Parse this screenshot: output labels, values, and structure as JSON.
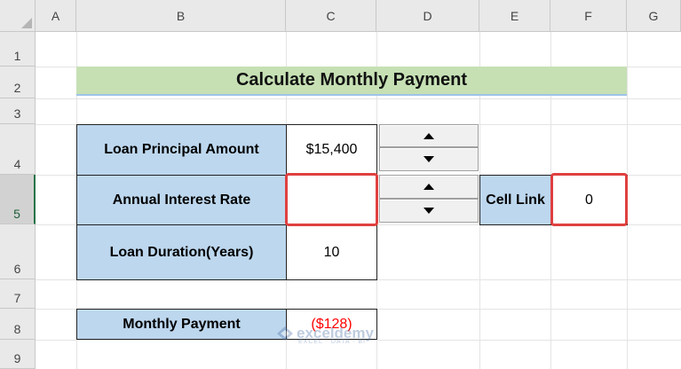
{
  "columns": [
    "A",
    "B",
    "C",
    "D",
    "E",
    "F",
    "G"
  ],
  "rows": [
    "1",
    "2",
    "3",
    "4",
    "5",
    "6",
    "7",
    "8",
    "9"
  ],
  "sheet": {
    "title": "Calculate Monthly Payment",
    "principal_label": "Loan Principal Amount",
    "principal_value": "$15,400",
    "rate_label": "Annual Interest Rate",
    "rate_value": "",
    "duration_label": "Loan Duration(Years)",
    "duration_value": "10",
    "payment_label": "Monthly Payment",
    "payment_value": "($128)",
    "cell_link_label": "Cell Link",
    "cell_link_value": "0"
  },
  "watermark": {
    "name": "exceldemy",
    "tagline": "EXCEL · DATA · BI"
  },
  "colors": {
    "label_fill": "#bdd7ee",
    "title_fill": "#c6e0b4",
    "highlight": "#e04040",
    "negative": "#ff0000"
  }
}
